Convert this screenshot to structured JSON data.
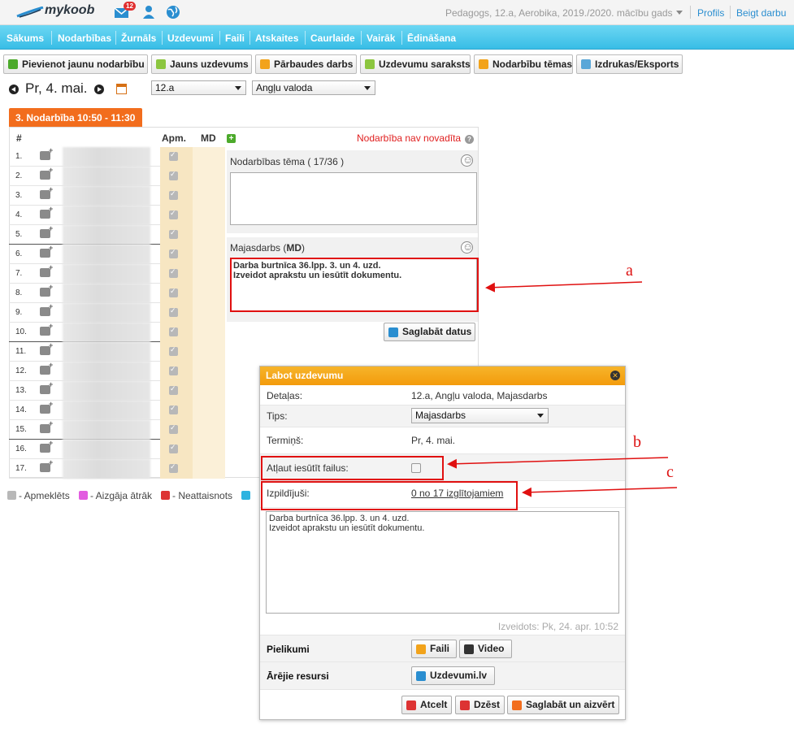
{
  "topbar": {
    "logo": "mykoob",
    "mail_count": "12",
    "user_info": "Pedagogs, 12.a, Aerobika, 2019./2020. mācību gads",
    "profile_link": "Profils",
    "logout_link": "Beigt darbu"
  },
  "nav": {
    "items": [
      "Sākums",
      "Nodarbības",
      "Žurnāls",
      "Uzdevumi",
      "Faili",
      "Atskaites",
      "Caurlaide",
      "Vairāk",
      "Ēdināšana"
    ],
    "active": "Žurnāls"
  },
  "toolbar": {
    "add_lesson": "Pievienot jaunu nodarbību",
    "new_task": "Jauns uzdevums",
    "test_work": "Pārbaudes darbs",
    "task_list": "Uzdevumu saraksts",
    "lesson_topics": "Nodarbību tēmas",
    "print_export": "Izdrukas/Eksports"
  },
  "date_row": {
    "date": "Pr, 4. mai.",
    "class_select": "12.a",
    "subject_select": "Angļu valoda"
  },
  "lesson": {
    "tab": "3. Nodarbība 10:50 - 11:30",
    "not_held": "Nodarbība nav novadīta",
    "headers": {
      "num": "#",
      "apm": "Apm.",
      "md": "MD"
    },
    "rows": [
      "1.",
      "2.",
      "3.",
      "4.",
      "5.",
      "6.",
      "7.",
      "8.",
      "9.",
      "10.",
      "11.",
      "12.",
      "13.",
      "14.",
      "15.",
      "16.",
      "17."
    ],
    "topic_label": "Nodarbības tēma ( 17/36 )",
    "homework_label_prefix": "Majasdarbs (",
    "homework_label_bold": "MD",
    "homework_label_suffix": ")",
    "homework_line1": "Darba burtnīca 36.lpp. 3. un 4. uzd.",
    "homework_line2": "Izveidot aprakstu un iesūtīt dokumentu.",
    "save_button": "Saglabāt datus"
  },
  "legend": {
    "attended": "- Apmeklēts",
    "left_early": "- Aizgāja ātrāk",
    "unexcused": "- Neattaisnots"
  },
  "modal": {
    "title": "Labot uzdevumu",
    "details_label": "Detaļas:",
    "details_value": "12.a, Angļu valoda, Majasdarbs",
    "type_label": "Tips:",
    "type_value": "Majasdarbs",
    "deadline_label": "Termiņš:",
    "deadline_value": "Pr, 4. mai.",
    "allow_files_label": "Atļaut iesūtīt failus:",
    "completed_label": "Izpildījuši:",
    "completed_value": "0 no 17 izglītojamiem",
    "text_line1": "Darba burtnīca 36.lpp. 3. un 4. uzd.",
    "text_line2": "Izveidot aprakstu un iesūtīt dokumentu.",
    "created": "Izveidots: Pk, 24. apr. 10:52",
    "attachments_label": "Pielikumi",
    "files_button": "Faili",
    "video_button": "Video",
    "external_label": "Ārējie resursi",
    "external_button": "Uzdevumi.lv",
    "cancel_button": "Atcelt",
    "delete_button": "Dzēst",
    "save_close_button": "Saglabāt un aizvērt"
  },
  "annotations": {
    "a": "a",
    "b": "b",
    "c": "c"
  },
  "colors": {
    "nav": "#38bde6",
    "orange": "#f26d1d",
    "red": "#e01010",
    "modal_header": "#f39b0c"
  }
}
